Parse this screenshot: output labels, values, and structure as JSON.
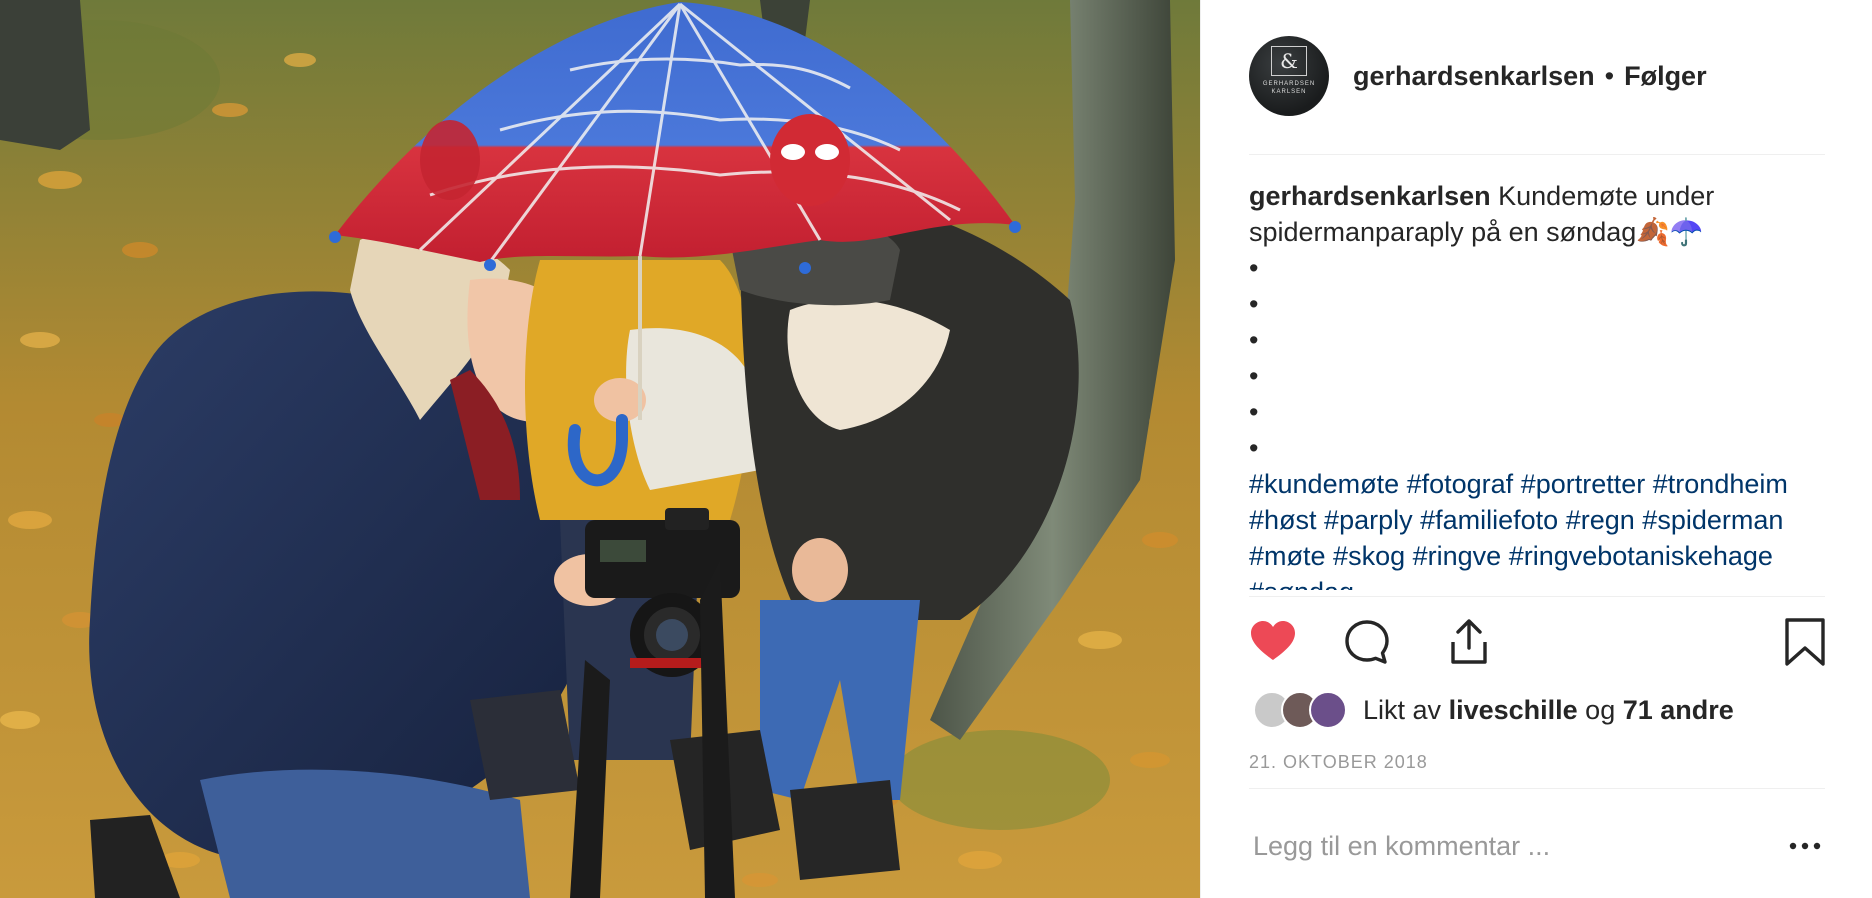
{
  "post": {
    "username": "gerhardsenkarlsen",
    "dot": "•",
    "follow_label": "Følger",
    "avatar": {
      "monogram": "&",
      "brand_text": "GERHARDSEN KARLSEN"
    },
    "caption": {
      "username": "gerhardsenkarlsen",
      "text": "Kundemøte under spidermanparaply på en søndag🍂☂️",
      "bullets": [
        "•",
        "•",
        "•",
        "•",
        "•",
        "•"
      ],
      "hashtags": [
        "#kundemøte",
        "#fotograf",
        "#portretter",
        "#trondheim",
        "#høst",
        "#parply",
        "#familiefoto",
        "#regn",
        "#spiderman",
        "#møte",
        "#skog",
        "#ringve",
        "#ringvebotaniskehage",
        "#søndag"
      ]
    },
    "actions": {
      "like_icon": "heart-filled-icon",
      "comment_icon": "speech-bubble-icon",
      "share_icon": "share-upload-icon",
      "save_icon": "bookmark-icon",
      "like_color": "#ed4956"
    },
    "likes": {
      "prefix": "Likt av",
      "user": "liveschille",
      "conjunction": "og",
      "others": "71 andre"
    },
    "date": "21. OKTOBER 2018",
    "comment": {
      "placeholder": "Legg til en kommentar ...",
      "more_icon": "more-options-icon"
    }
  }
}
